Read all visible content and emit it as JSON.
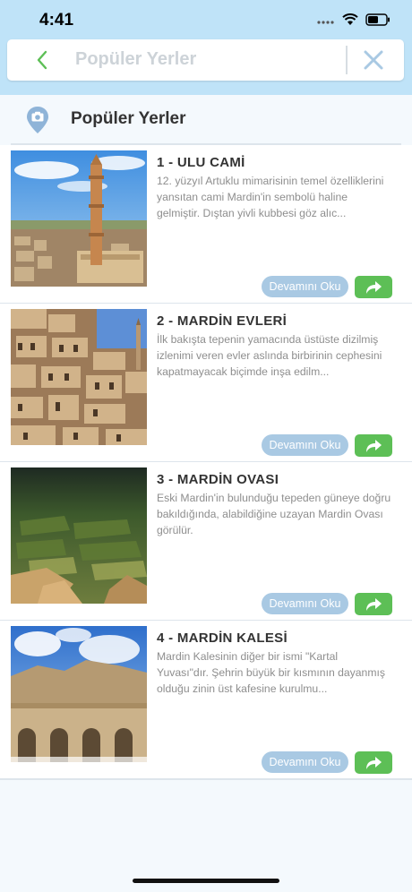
{
  "status_bar": {
    "time": "4:41"
  },
  "header": {
    "title": "Popüler Yerler"
  },
  "section": {
    "title": "Popüler Yerler"
  },
  "places": [
    {
      "title": "1 - ULU CAMİ",
      "description": "12. yüzyıl Artuklu mimarisinin temel özelliklerini yansıtan cami Mardin'in sembolü haline gelmiştir. Dıştan yivli kubbesi göz alıc...",
      "more_label": "Devamını Oku"
    },
    {
      "title": "2 - MARDİN EVLERİ",
      "description": "İlk bakışta tepenin yamacında üstüste dizilmiş izlenimi veren evler aslında birbirinin cephesini kapatmayacak biçimde inşa edilm...",
      "more_label": "Devamını Oku"
    },
    {
      "title": "3 - MARDİN OVASI",
      "description": "Eski Mardin'in bulunduğu tepeden güneye doğru bakıldığında, alabildiğine uzayan Mardin Ovası görülür.",
      "more_label": "Devamını Oku"
    },
    {
      "title": "4 - MARDİN KALESİ",
      "description": "Mardin Kalesinin diğer bir ismi \"Kartal Yuvası\"dır. Şehrin büyük bir kısmının dayanmış olduğu zinin üst kafesine kurulmu...",
      "more_label": "Devamını Oku"
    }
  ],
  "colors": {
    "header_bg": "#bfe3f8",
    "accent_green": "#5dbf56",
    "read_more_bg": "#a9c9e3",
    "location_icon": "#8fb4d8"
  },
  "icons": {
    "back": "chevron-left-icon",
    "close": "close-icon",
    "section": "location-camera-icon",
    "share": "share-arrow-icon"
  }
}
